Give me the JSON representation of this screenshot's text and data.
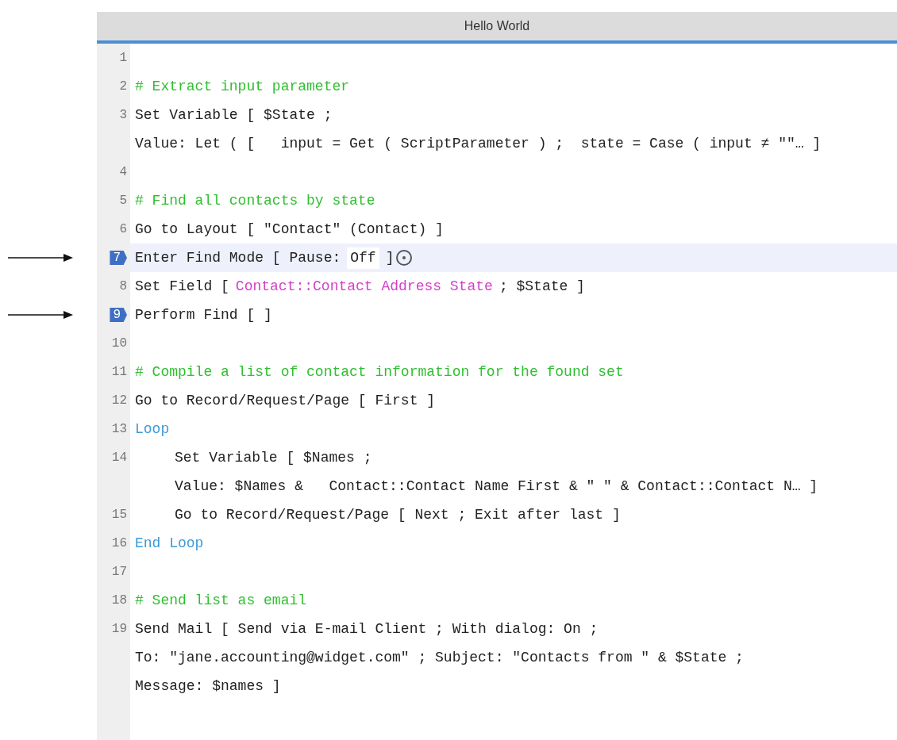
{
  "window": {
    "title": "Hello World"
  },
  "steps": [
    {
      "number": "1",
      "selected": false,
      "breakpoint": false
    },
    {
      "number": "2",
      "selected": false,
      "breakpoint": false,
      "rows": [
        [
          {
            "text": "# Extract input parameter",
            "kind": "comment"
          }
        ]
      ]
    },
    {
      "number": "3",
      "selected": false,
      "breakpoint": false,
      "rows": [
        [
          {
            "text": "Set Variable [ $State ;",
            "kind": "plain"
          }
        ],
        [
          {
            "text": "Value: Let ( [   input = Get ( ScriptParameter ) ;  state = Case ( input ≠ \"\"… ]",
            "kind": "plain"
          }
        ]
      ]
    },
    {
      "number": "4",
      "selected": false,
      "breakpoint": false
    },
    {
      "number": "5",
      "selected": false,
      "breakpoint": false,
      "rows": [
        [
          {
            "text": "# Find all contacts by state",
            "kind": "comment"
          }
        ]
      ]
    },
    {
      "number": "6",
      "selected": false,
      "breakpoint": false,
      "rows": [
        [
          {
            "text": "Go to Layout [ \"Contact\" (Contact) ]",
            "kind": "plain"
          }
        ]
      ]
    },
    {
      "number": "7",
      "selected": true,
      "breakpoint": true,
      "options": true,
      "rows": [
        [
          {
            "text": "Enter Find Mode [ Pause:",
            "kind": "plain"
          },
          {
            "text": "Off",
            "kind": "value"
          },
          {
            "text": "]",
            "kind": "plain"
          }
        ]
      ]
    },
    {
      "number": "8",
      "selected": false,
      "breakpoint": false,
      "rows": [
        [
          {
            "text": "Set Field [",
            "kind": "plain"
          },
          {
            "text": "Contact::Contact Address State",
            "kind": "field"
          },
          {
            "text": "; $State ]",
            "kind": "plain"
          }
        ]
      ]
    },
    {
      "number": "9",
      "selected": false,
      "breakpoint": true,
      "rows": [
        [
          {
            "text": "Perform Find [ ]",
            "kind": "plain"
          }
        ]
      ]
    },
    {
      "number": "10",
      "selected": false,
      "breakpoint": false
    },
    {
      "number": "11",
      "selected": false,
      "breakpoint": false,
      "rows": [
        [
          {
            "text": "# Compile a list of contact information for the found set",
            "kind": "comment"
          }
        ]
      ]
    },
    {
      "number": "12",
      "selected": false,
      "breakpoint": false,
      "rows": [
        [
          {
            "text": "Go to Record/Request/Page [ First ]",
            "kind": "plain"
          }
        ]
      ]
    },
    {
      "number": "13",
      "selected": false,
      "breakpoint": false,
      "rows": [
        [
          {
            "text": "Loop",
            "kind": "control"
          }
        ]
      ],
      "children": [
        {
          "number": "14",
          "selected": false,
          "breakpoint": false,
          "rows": [
            [
              {
                "text": "Set Variable [ $Names ;",
                "kind": "plain"
              }
            ],
            [
              {
                "text": "Value: $Names &   Contact::Contact Name First & \" \" & Contact::Contact N… ]",
                "kind": "plain"
              }
            ]
          ]
        },
        {
          "number": "15",
          "selected": false,
          "breakpoint": false,
          "rows": [
            [
              {
                "text": "Go to Record/Request/Page [ Next ; Exit after last ]",
                "kind": "plain"
              }
            ]
          ]
        }
      ]
    },
    {
      "number": "16",
      "selected": false,
      "breakpoint": false,
      "rows": [
        [
          {
            "text": "End Loop",
            "kind": "control"
          }
        ]
      ]
    },
    {
      "number": "17",
      "selected": false,
      "breakpoint": false
    },
    {
      "number": "18",
      "selected": false,
      "breakpoint": false,
      "rows": [
        [
          {
            "text": "# Send list as email",
            "kind": "comment"
          }
        ]
      ]
    },
    {
      "number": "19",
      "selected": false,
      "breakpoint": false,
      "rows": [
        [
          {
            "text": "Send Mail [ Send via E-mail Client ; With dialog: On ;",
            "kind": "plain"
          }
        ],
        [
          {
            "text": "To: \"jane.accounting@widget.com\" ; Subject: \"Contacts from \" & $State ;",
            "kind": "plain"
          }
        ],
        [
          {
            "text": "Message: $names ]",
            "kind": "plain"
          }
        ]
      ]
    }
  ]
}
